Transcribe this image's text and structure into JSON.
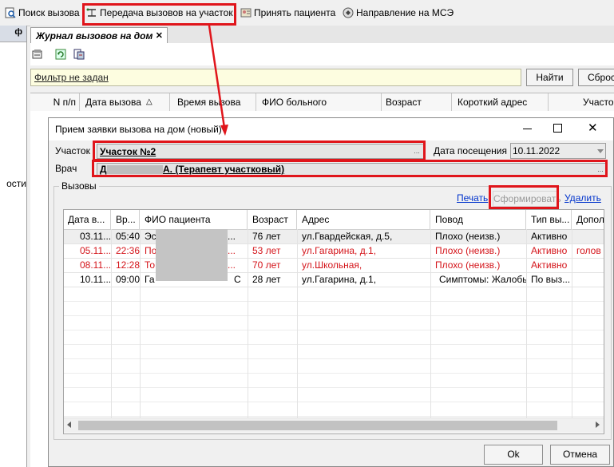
{
  "toolbar": {
    "search_call": "Поиск вызова",
    "transfer_calls": "Передача вызовов на участок",
    "accept_patient": "Принять пациента",
    "mse_referral": "Направление на МСЭ"
  },
  "left_panel": {
    "pin": "ф",
    "truncated_text": "ости"
  },
  "tab": {
    "title": "Журнал вызовов на дом",
    "close": "✕"
  },
  "filter": {
    "text": "Фильтр не задан",
    "find_button": "Найти",
    "reset_button": "Сброс"
  },
  "journal_columns": [
    "N п/п",
    "Дата вызова",
    "Время вызова",
    "ФИО больного",
    "Возраст",
    "Короткий адрес",
    "Участок"
  ],
  "dialog": {
    "title": "Прием заявки вызова на дом (новый)",
    "district_label": "Участок",
    "district_value": "Участок №2",
    "visit_date_label": "Дата посещения",
    "visit_date_value": "10.11.2022",
    "doctor_label": "Врач",
    "doctor_value_prefix": "Д",
    "doctor_value_suffix": "А. (Терапевт участковый)",
    "ellipsis": "...",
    "group_label": "Вызовы",
    "print_link": "Печать",
    "form_button": "Сформировать",
    "delete_link": "Удалить",
    "ok_button": "Ok",
    "cancel_button": "Отмена"
  },
  "calls_table": {
    "columns": [
      "Дата в...",
      "Вр...",
      "ФИО пациента",
      "Возраст",
      "Адрес",
      "Повод",
      "Тип вы...",
      "Допол"
    ],
    "rows": [
      {
        "date": "03.11...",
        "time": "05:40",
        "name": "Эс",
        "name_tail": "...",
        "age": "76 лет",
        "address": "ул.Гвардейская, д.5,",
        "reason": "Плохо (неизв.)",
        "type": "Активно",
        "extra": "",
        "red": false
      },
      {
        "date": "05.11...",
        "time": "22:36",
        "name": "По",
        "name_tail": "...",
        "age": "53 лет",
        "address": "ул.Гагарина, д.1,",
        "reason": "Плохо (неизв.)",
        "type": "Активно",
        "extra": "голов",
        "red": true
      },
      {
        "date": "08.11...",
        "time": "12:28",
        "name": "То",
        "name_tail": "...",
        "age": "70 лет",
        "address": "ул.Школьная,",
        "reason": "Плохо (неизв.)",
        "type": "Активно",
        "extra": "",
        "red": true
      },
      {
        "date": "10.11...",
        "time": "09:00",
        "name": "Га",
        "name_tail": "С",
        "age": "28 лет",
        "address": "ул.Гагарина, д.1,",
        "reason": "Симптомы: Жалобы",
        "type": "По выз...",
        "extra": "",
        "red": false
      }
    ]
  },
  "colors": {
    "highlight": "#e0151b",
    "link": "#0033cc",
    "alert_text": "#d4141a",
    "filter_bg": "#fdfde0"
  },
  "icons": [
    "search-call-icon",
    "transfer-icon",
    "accept-patient-icon",
    "mse-referral-icon",
    "properties-icon",
    "refresh-icon",
    "export-icon",
    "pin-icon",
    "minimize-icon",
    "maximize-icon",
    "close-icon",
    "dropdown-arrow-icon",
    "sort-up-icon",
    "scroll-left-icon",
    "scroll-right-icon"
  ]
}
